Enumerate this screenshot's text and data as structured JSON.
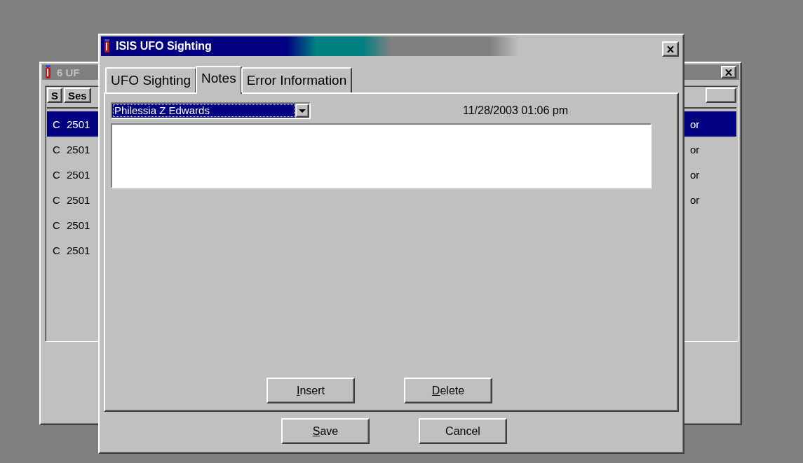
{
  "background_window": {
    "title": "6 UF",
    "columns": [
      {
        "label": "S"
      },
      {
        "label": "Ses"
      }
    ],
    "rows": [
      {
        "status": "C",
        "session": "2501",
        "column_3": "or",
        "selected": true
      },
      {
        "status": "C",
        "session": "2501",
        "column_3": "or",
        "selected": false
      },
      {
        "status": "C",
        "session": "2501",
        "column_3": "or",
        "selected": false
      },
      {
        "status": "C",
        "session": "2501",
        "column_3": "or",
        "selected": false
      },
      {
        "status": "C",
        "session": "2501",
        "selected": false
      },
      {
        "status": "C",
        "session": "2501",
        "selected": false
      }
    ]
  },
  "dialog": {
    "title": "ISIS UFO Sighting",
    "tabs": [
      {
        "label": "UFO Sighting",
        "selected": false
      },
      {
        "label": "Notes",
        "selected": true
      },
      {
        "label": "Error Information",
        "selected": false
      }
    ],
    "note_author": {
      "value": "Philessia Z Edwards"
    },
    "timestamp": "11/28/2003 01:06 pm",
    "buttons": [
      {
        "label": "Insert",
        "underline_first": true
      },
      {
        "label": "Delete",
        "underline_first": true
      }
    ],
    "footer_buttons": [
      {
        "label": "Save",
        "underline_first": true
      },
      {
        "label": "Cancel",
        "underline_first": false
      }
    ]
  }
}
